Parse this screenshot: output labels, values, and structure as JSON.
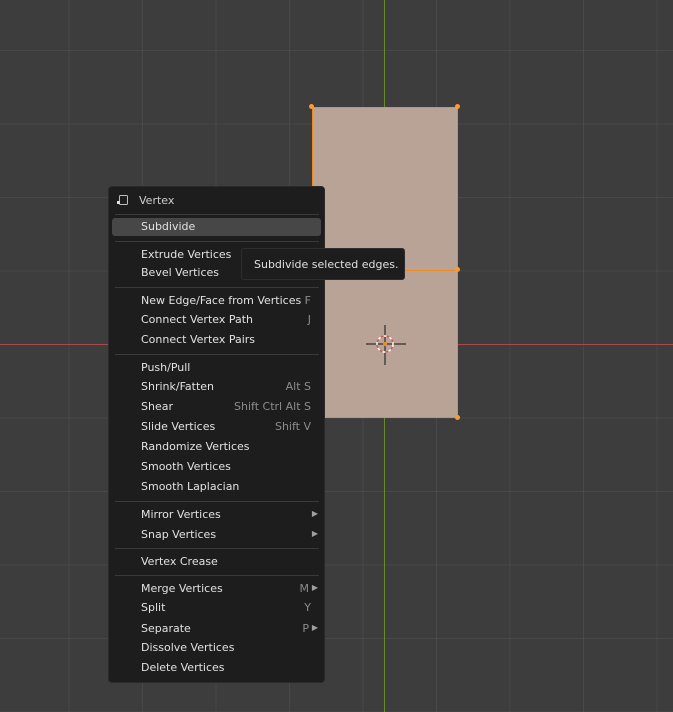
{
  "menu": {
    "title": "Vertex",
    "items": [
      {
        "label": "Subdivide",
        "shortcut": "",
        "submenu": false,
        "active": true
      },
      {
        "label": "Extrude Vertices",
        "shortcut": "",
        "submenu": false
      },
      {
        "label": "Bevel Vertices",
        "shortcut": "",
        "submenu": false
      },
      {
        "label": "New Edge/Face from Vertices",
        "shortcut": "F",
        "submenu": false
      },
      {
        "label": "Connect Vertex Path",
        "shortcut": "J",
        "submenu": false
      },
      {
        "label": "Connect Vertex Pairs",
        "shortcut": "",
        "submenu": false
      },
      {
        "label": "Push/Pull",
        "shortcut": "",
        "submenu": false
      },
      {
        "label": "Shrink/Fatten",
        "shortcut": "Alt S",
        "submenu": false
      },
      {
        "label": "Shear",
        "shortcut": "Shift Ctrl Alt S",
        "submenu": false
      },
      {
        "label": "Slide Vertices",
        "shortcut": "Shift V",
        "submenu": false
      },
      {
        "label": "Randomize Vertices",
        "shortcut": "",
        "submenu": false
      },
      {
        "label": "Smooth Vertices",
        "shortcut": "",
        "submenu": false
      },
      {
        "label": "Smooth Laplacian",
        "shortcut": "",
        "submenu": false
      },
      {
        "label": "Mirror Vertices",
        "shortcut": "",
        "submenu": true
      },
      {
        "label": "Snap Vertices",
        "shortcut": "",
        "submenu": true
      },
      {
        "label": "Vertex Crease",
        "shortcut": "",
        "submenu": false
      },
      {
        "label": "Merge Vertices",
        "shortcut": "M",
        "submenu": true
      },
      {
        "label": "Split",
        "shortcut": "Y",
        "submenu": false
      },
      {
        "label": "Separate",
        "shortcut": "P",
        "submenu": true
      },
      {
        "label": "Dissolve Vertices",
        "shortcut": "",
        "submenu": false
      },
      {
        "label": "Delete Vertices",
        "shortcut": "",
        "submenu": false
      }
    ],
    "submenu_arrow": "▶"
  },
  "tooltip": {
    "text": "Subdivide selected edges."
  },
  "colors": {
    "selection_outline": "#f08a24",
    "face_fill": "#b9a397",
    "x_axis": "#a84a4a",
    "y_axis": "#6a8a2a",
    "menu_background": "#1d1d1d",
    "active_item": "#474747"
  },
  "icons": {
    "menu_header": "mesh-vertex-icon",
    "viewport_cursor": "3d-cursor-icon"
  }
}
